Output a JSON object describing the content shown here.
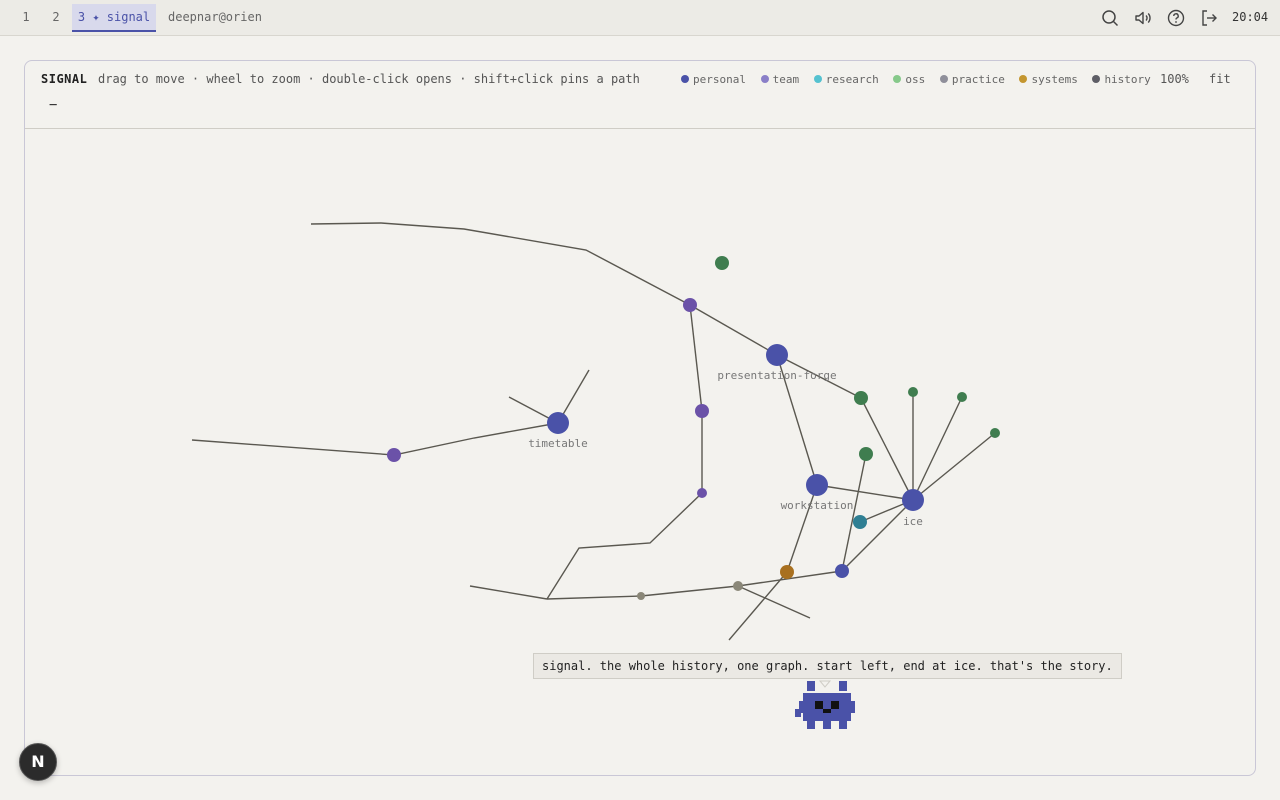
{
  "topbar": {
    "workspaces": [
      {
        "label": "1",
        "active": false
      },
      {
        "label": "2",
        "active": false
      },
      {
        "label": "3 ✦ signal",
        "active": true
      }
    ],
    "userhost": "deepnar@orien",
    "icons": [
      "search-icon",
      "volume-icon",
      "help-icon",
      "logout-icon"
    ],
    "clock": "20:04"
  },
  "panel": {
    "title": "SIGNAL",
    "hint": "drag to move · wheel to zoom · double-click opens · shift+click pins a path",
    "legend": [
      {
        "label": "personal",
        "color": "#4a52a8"
      },
      {
        "label": "team",
        "color": "#8a7fc8"
      },
      {
        "label": "research",
        "color": "#55c2d0"
      },
      {
        "label": "oss",
        "color": "#86c98a"
      },
      {
        "label": "practice",
        "color": "#8f8f9a"
      },
      {
        "label": "systems",
        "color": "#c4962f"
      },
      {
        "label": "history",
        "color": "#5e5e66"
      }
    ],
    "zoom": "100%",
    "fit_label": "fit",
    "minus_label": "−"
  },
  "graph": {
    "labels": {
      "presentation_forge": "presentation-forge",
      "timetable": "timetable",
      "workstation": "workstation",
      "ice": "ice"
    },
    "colors": {
      "personal": "#4a52a8",
      "team": "#6b52a8",
      "oss": "#3f7d4f",
      "research": "#2f7f93",
      "systems": "#a8701f",
      "practice": "#8a8778"
    }
  },
  "tooltip": "signal. the whole history, one graph. start left, end at ice. that's the story.",
  "logo": "N"
}
